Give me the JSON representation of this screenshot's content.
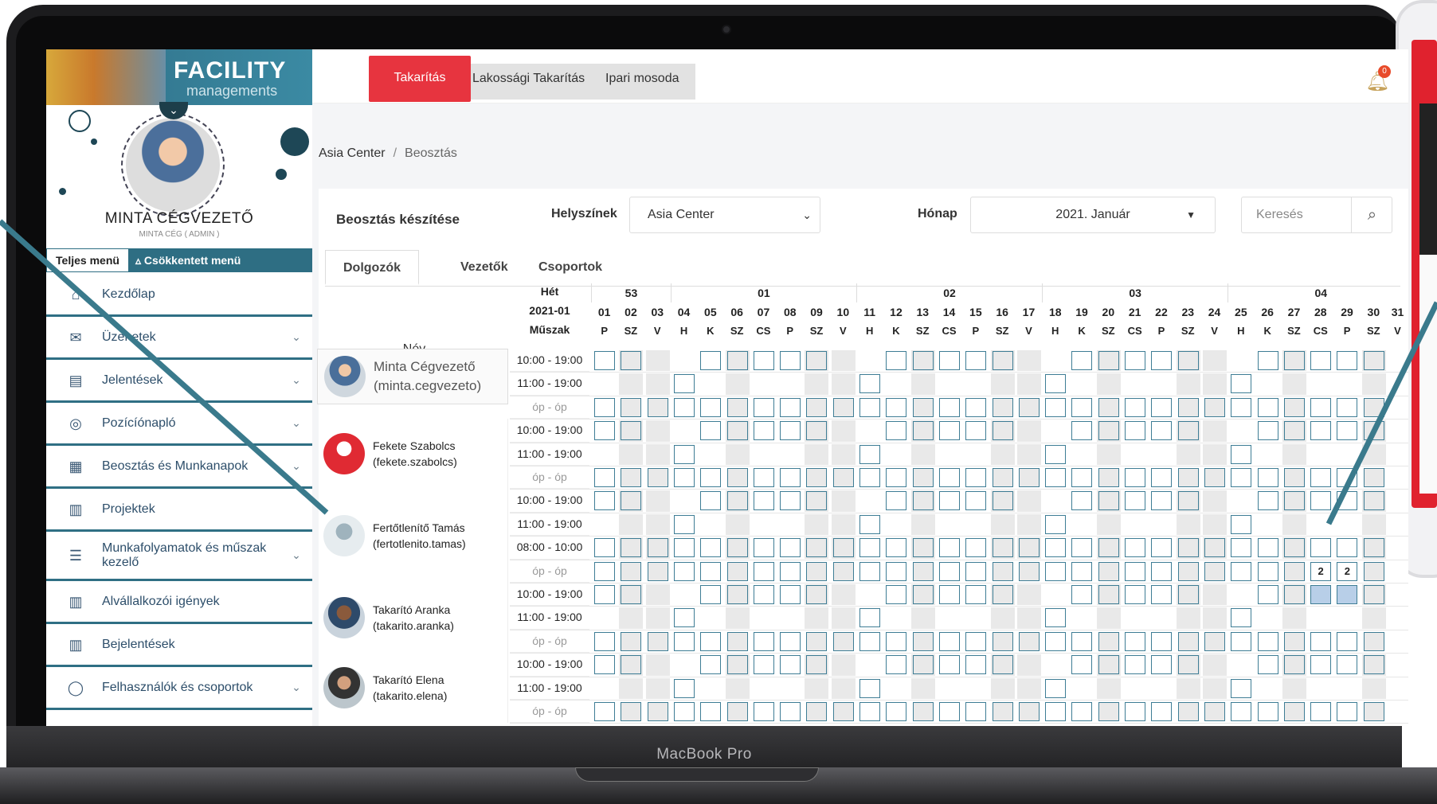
{
  "device": {
    "label": "MacBook Pro"
  },
  "logo": {
    "title": "FACILITY",
    "subtitle": "managements"
  },
  "user": {
    "name": "MINTA CÉGVEZETŐ",
    "role": "MINTA CÉG ( ADMIN )"
  },
  "menu_toggle": {
    "full": "Teljes menü",
    "reduced": "Csökkentett menü"
  },
  "nav": [
    {
      "label": "Kezdőlap",
      "icon": "home-icon",
      "caret": false
    },
    {
      "label": "Üzenetek",
      "icon": "mail-icon",
      "caret": true
    },
    {
      "label": "Jelentések",
      "icon": "document-icon",
      "caret": true
    },
    {
      "label": "Pozícíónapló",
      "icon": "location-pin-icon",
      "caret": true
    },
    {
      "label": "Beosztás és Munkanapok",
      "icon": "calendar-icon",
      "caret": true
    },
    {
      "label": "Projektek",
      "icon": "clipboard-icon",
      "caret": false
    },
    {
      "label": "Munkafolyamatok és műszak kezelő",
      "icon": "checklist-icon",
      "caret": true
    },
    {
      "label": "Alvállalkozói igények",
      "icon": "clipboard-icon",
      "caret": false
    },
    {
      "label": "Bejelentések",
      "icon": "clipboard-icon",
      "caret": false
    },
    {
      "label": "Felhasználók és csoportok",
      "icon": "user-icon",
      "caret": true
    }
  ],
  "top_tabs": [
    "Takarítás",
    "Lakossági Takarítás",
    "Ipari mosoda"
  ],
  "notifications": {
    "count": "0"
  },
  "breadcrumb": {
    "parent": "Asia Center",
    "sep": "/",
    "current": "Beosztás"
  },
  "card": {
    "title": "Beosztás készítése",
    "location_label": "Helyszínek",
    "location_value": "Asia Center",
    "month_label": "Hónap",
    "month_value": "2021. Január",
    "search_placeholder": "Keresés"
  },
  "sub_tabs": [
    "Dolgozók",
    "Vezetők",
    "Csoportok"
  ],
  "schedule": {
    "name_header": "Név",
    "week_label": "Hét",
    "month_label": "2021-01",
    "shift_label": "Műszak",
    "weeks": [
      {
        "label": "53",
        "days": 3
      },
      {
        "label": "01",
        "days": 7
      },
      {
        "label": "02",
        "days": 7
      },
      {
        "label": "03",
        "days": 7
      },
      {
        "label": "04",
        "days": 7
      }
    ],
    "days": [
      "01",
      "02",
      "03",
      "04",
      "05",
      "06",
      "07",
      "08",
      "09",
      "10",
      "11",
      "12",
      "13",
      "14",
      "15",
      "16",
      "17",
      "18",
      "19",
      "20",
      "21",
      "22",
      "23",
      "24",
      "25",
      "26",
      "27",
      "28",
      "29",
      "30",
      "31"
    ],
    "weekdays": [
      "P",
      "SZ",
      "V",
      "H",
      "K",
      "SZ",
      "CS",
      "P",
      "SZ",
      "V",
      "H",
      "K",
      "SZ",
      "CS",
      "P",
      "SZ",
      "V",
      "H",
      "K",
      "SZ",
      "CS",
      "P",
      "SZ",
      "V",
      "H",
      "K",
      "SZ",
      "CS",
      "P",
      "SZ",
      "V"
    ],
    "employees": [
      {
        "name": "Minta Cégvezető",
        "login": "(minta.cegvezeto)",
        "shifts": [
          "10:00 - 19:00",
          "11:00 - 19:00",
          "óp - óp"
        ]
      },
      {
        "name": "Fekete Szabolcs",
        "login": "(fekete.szabolcs)",
        "shifts": [
          "10:00 - 19:00",
          "11:00 - 19:00",
          "óp - óp"
        ]
      },
      {
        "name": "Fertőtlenítő Tamás",
        "login": "(fertotlenito.tamas)",
        "shifts": [
          "10:00 - 19:00",
          "11:00 - 19:00",
          "08:00 - 10:00",
          "óp - óp"
        ]
      },
      {
        "name": "Takarító Aranka",
        "login": "(takarito.aranka)",
        "shifts": [
          "10:00 - 19:00",
          "11:00 - 19:00",
          "óp - óp"
        ]
      },
      {
        "name": "Takarító Elena",
        "login": "(takarito.elena)",
        "shifts": [
          "10:00 - 19:00",
          "11:00 - 19:00",
          "óp - óp"
        ]
      }
    ],
    "cell_values": [
      {
        "row": 9,
        "day": "28",
        "text": "2"
      },
      {
        "row": 9,
        "day": "29",
        "text": "2"
      }
    ],
    "highlighted": [
      {
        "row": 10,
        "day": "28"
      },
      {
        "row": 10,
        "day": "29"
      }
    ]
  }
}
